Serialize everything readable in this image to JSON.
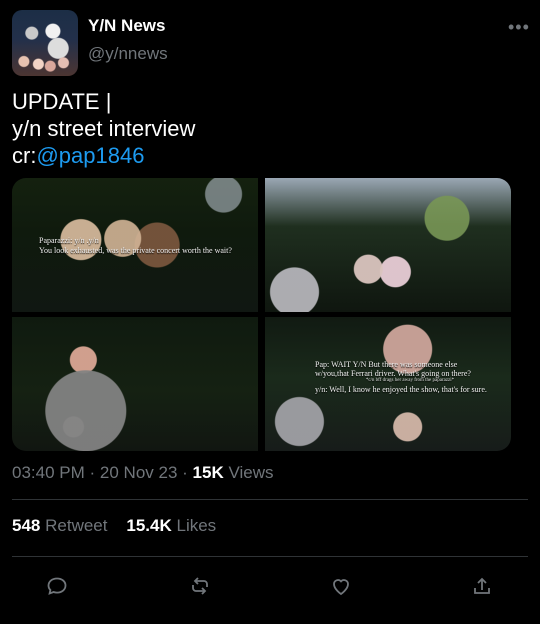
{
  "tweet": {
    "display_name": "Y/N News",
    "handle": "@y/nnews",
    "text_line1": "UPDATE |",
    "text_line2": "y/n street interview",
    "text_line3_prefix": "cr:",
    "text_line3_link": "@pap1846",
    "time": "03:40 PM",
    "separator1": "·",
    "date": "20 Nov 23",
    "separator2": "·",
    "views_count": "15K",
    "views_label": "Views",
    "retweet_count": "548",
    "retweet_label": "Retweet",
    "likes_count": "15.4K",
    "likes_label": "Likes"
  },
  "media": {
    "caption1_line1": "Paparazzi: y/n .y/n",
    "caption1_line2": "You look exhausted, was the private concert worth the wait?",
    "caption4_line1": "Pap: WAIT Y/N But there was someone else",
    "caption4_line2": "w/you,that Ferrari driver. What's going on there?",
    "caption4_line3": "*c/n bff drags her away from the paparazzi*",
    "caption4_line4": "y/n: Well, I know he enjoyed the show, that's for sure."
  },
  "icons": {
    "more": "more-icon",
    "reply": "reply-icon",
    "retweet": "retweet-icon",
    "like": "like-icon",
    "share": "share-icon"
  },
  "colors": {
    "background": "#000000",
    "text": "#e7e9ea",
    "muted": "#71767b",
    "link": "#1d9bf0",
    "divider": "#2f3336"
  }
}
